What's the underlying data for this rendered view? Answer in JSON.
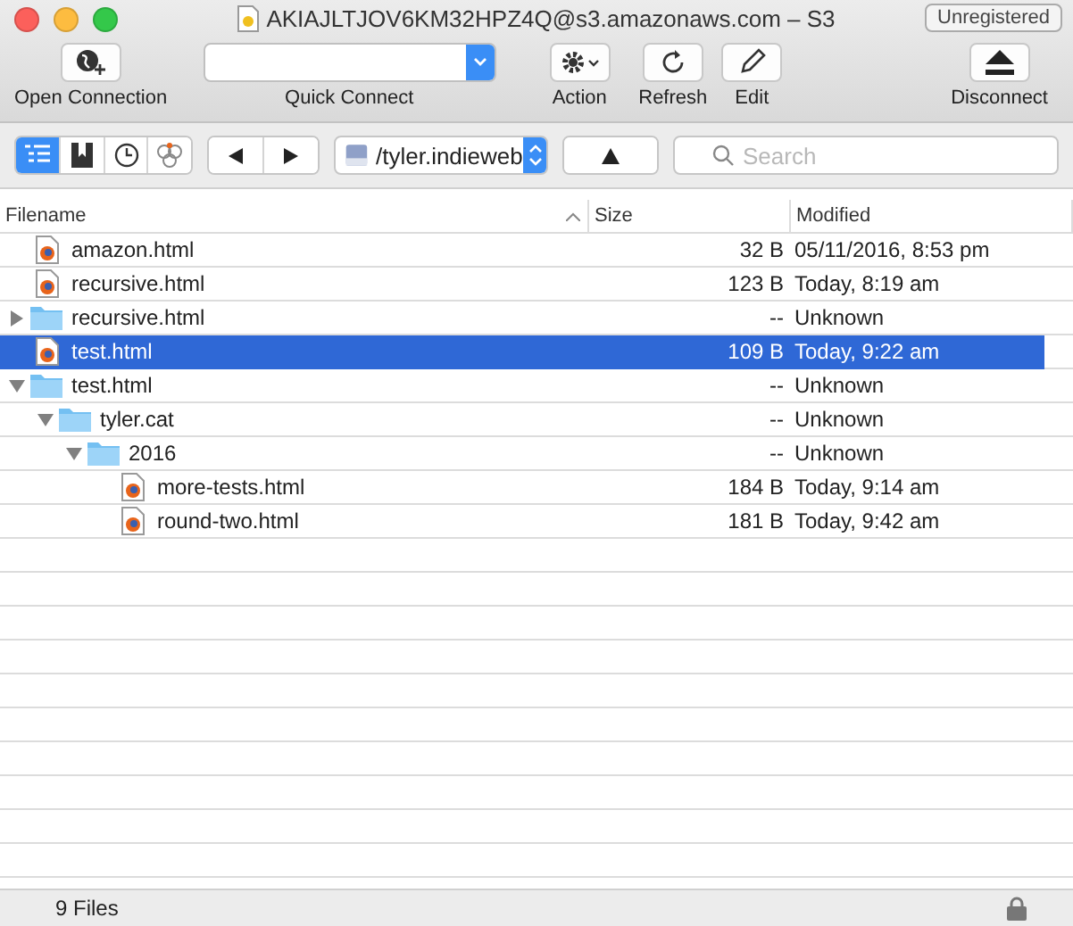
{
  "window": {
    "title": "AKIAJLTJOV6KM32HPZ4Q@s3.amazonaws.com – S3",
    "badge": "Unregistered"
  },
  "toolbar": [
    {
      "kind": "connect",
      "label": "Open Connection"
    },
    {
      "kind": "quick",
      "label": "Quick Connect"
    },
    {
      "kind": "action",
      "label": "Action"
    },
    {
      "kind": "refresh",
      "label": "Refresh"
    },
    {
      "kind": "edit",
      "label": "Edit"
    },
    {
      "kind": "spacer"
    },
    {
      "kind": "disconnect",
      "label": "Disconnect"
    }
  ],
  "view_modes": [
    {
      "kind": "browser",
      "selected": true
    },
    {
      "kind": "bookmarks",
      "selected": false
    },
    {
      "kind": "history",
      "selected": false
    },
    {
      "kind": "bonjour",
      "selected": false
    }
  ],
  "path": "/tyler.indieweb",
  "search": {
    "placeholder": "Search"
  },
  "table": {
    "columns": [
      "Filename",
      "Size",
      "Modified"
    ],
    "rows": [
      {
        "kind": "file",
        "name": "amazon.html",
        "size": "32 B",
        "modified": "05/11/2016, 8:53 pm",
        "selected": false
      },
      {
        "kind": "file",
        "name": "recursive.html",
        "size": "123 B",
        "modified": "Today, 8:19 am",
        "selected": false
      },
      {
        "kind": "folder",
        "name": "recursive.html",
        "size": "--",
        "modified": "Unknown",
        "selected": false,
        "expanded": false
      },
      {
        "kind": "file",
        "name": "test.html",
        "size": "109 B",
        "modified": "Today, 9:22 am",
        "selected": true
      },
      {
        "kind": "folder",
        "name": "test.html",
        "size": "--",
        "modified": "Unknown",
        "selected": false,
        "expanded": true,
        "children": [
          {
            "kind": "folder",
            "name": "tyler.cat",
            "size": "--",
            "modified": "Unknown",
            "selected": false,
            "expanded": true,
            "children": [
              {
                "kind": "folder",
                "name": "2016",
                "size": "--",
                "modified": "Unknown",
                "selected": false,
                "expanded": true,
                "children": [
                  {
                    "kind": "file",
                    "name": "more-tests.html",
                    "size": "184 B",
                    "modified": "Today, 9:14 am",
                    "selected": false
                  },
                  {
                    "kind": "file",
                    "name": "round-two.html",
                    "size": "181 B",
                    "modified": "Today, 9:42 am",
                    "selected": false
                  }
                ]
              }
            ]
          }
        ]
      }
    ]
  },
  "status_bar": {
    "text": "9 Files"
  }
}
